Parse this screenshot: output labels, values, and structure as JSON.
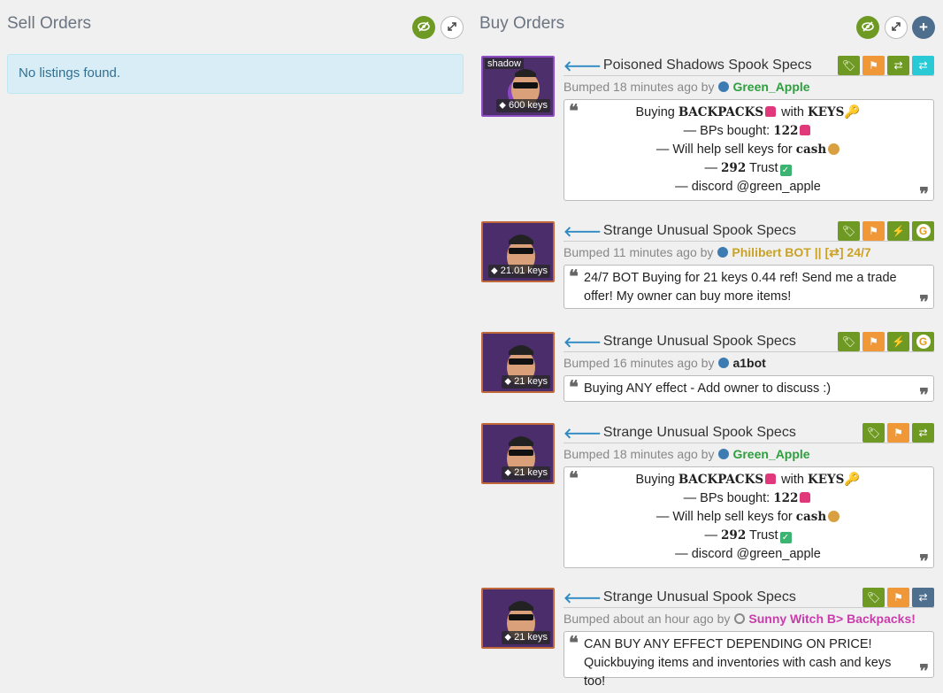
{
  "sell": {
    "title": "Sell Orders",
    "empty_message": "No listings found."
  },
  "buy": {
    "title": "Buy Orders"
  },
  "listings": [
    {
      "name": "Poisoned Shadows Spook Specs",
      "price": "600 keys",
      "effect": "shadow",
      "bumped": "Bumped 18 minutes ago by",
      "user": "Green_Apple",
      "user_color": "#2e9e3e",
      "lines": [
        "Buying",
        "BACKPACKS",
        "with",
        "KEYS",
        "— BPs bought:",
        "122",
        "— Will help sell keys for",
        "cash",
        "—",
        "292",
        "Trust",
        "— discord @green_apple"
      ]
    },
    {
      "name": "Strange Unusual Spook Specs",
      "price": "21.01 keys",
      "bumped": "Bumped 11 minutes ago by",
      "user": "Philibert BOT || [⇄] 24/7",
      "user_color": "#c9a227",
      "message": "24/7 BOT Buying for 21 keys 0.44 ref! Send me a trade offer! My owner can buy more items!"
    },
    {
      "name": "Strange Unusual Spook Specs",
      "price": "21 keys",
      "bumped": "Bumped 16 minutes ago by",
      "user": "a1bot",
      "user_color": "#222222",
      "message": "Buying ANY effect - Add owner to discuss :)"
    },
    {
      "name": "Strange Unusual Spook Specs",
      "price": "21 keys",
      "bumped": "Bumped 18 minutes ago by",
      "user": "Green_Apple",
      "user_color": "#2e9e3e",
      "lines": [
        "Buying",
        "BACKPACKS",
        "with",
        "KEYS",
        "— BPs bought:",
        "122",
        "— Will help sell keys for",
        "cash",
        "—",
        "292",
        "Trust",
        "— discord @green_apple"
      ]
    },
    {
      "name": "Strange Unusual Spook Specs",
      "price": "21 keys",
      "bumped": "Bumped about an hour ago by",
      "user": "Sunny Witch B> Backpacks!",
      "user_color": "#c83dab",
      "message": "CAN BUY ANY EFFECT DEPENDING ON PRICE! Quickbuying items and inventories with cash and keys too!"
    }
  ],
  "icons": {
    "eye_slash": "eye-slash-icon",
    "expand": "expand-icon",
    "plus": "plus-icon",
    "tag": "tag-icon",
    "flag": "flag-icon",
    "exchange": "exchange-icon",
    "bolt": "bolt-icon",
    "g_logo": "g-logo-icon"
  }
}
